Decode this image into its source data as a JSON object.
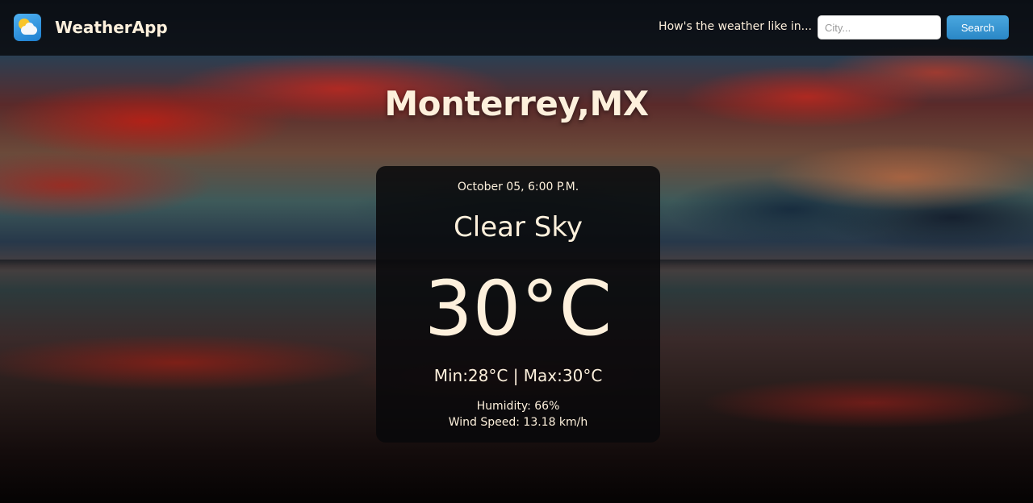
{
  "header": {
    "logo_icon": "weather-sun-cloud-icon",
    "brand": "WeatherApp",
    "search_prompt": "How's the weather like in...",
    "search_placeholder": "City...",
    "search_value": "",
    "search_button": "Search"
  },
  "location": {
    "city": "Monterrey,MX"
  },
  "weather": {
    "datetime": "October 05, 6:00 P.M.",
    "description": "Clear Sky",
    "temperature": "30°C",
    "minmax": "Min:28°C | Max:30°C",
    "humidity": "Humidity: 66%",
    "wind": "Wind Speed: 13.18 km/h"
  },
  "colors": {
    "text": "#fdf0dc",
    "button": "#2a87c6",
    "navbar": "#080a0e",
    "card": "#08080a"
  }
}
